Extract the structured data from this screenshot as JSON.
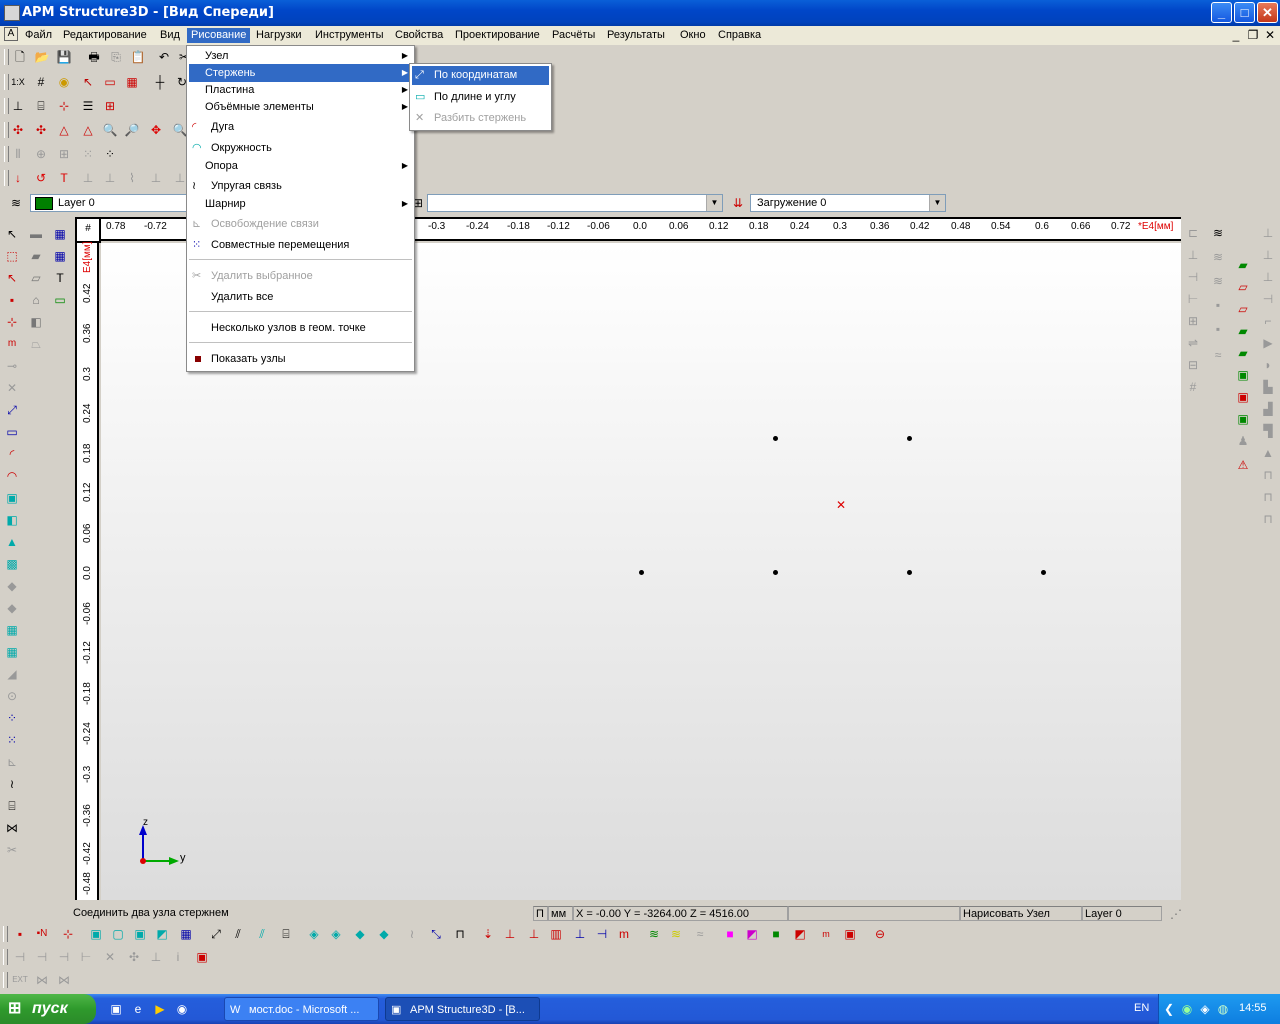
{
  "window": {
    "title": "APM Structure3D - [Вид Спереди]"
  },
  "menubar": [
    "Файл",
    "Редактирование",
    "Вид",
    "Рисование",
    "Нагрузки",
    "Инструменты",
    "Свойства",
    "Проектирование",
    "Расчёты",
    "Результаты",
    "Окно",
    "Справка"
  ],
  "draw_menu": {
    "items": [
      {
        "label": "Узел",
        "submenu": true
      },
      {
        "label": "Стержень",
        "submenu": true,
        "highlighted": true
      },
      {
        "label": "Пластина",
        "submenu": true
      },
      {
        "label": "Объёмные элементы",
        "submenu": true
      },
      {
        "label": "Дуга",
        "icon": "arc-icon"
      },
      {
        "label": "Окружность",
        "icon": "circle-icon"
      },
      {
        "label": "Опора",
        "submenu": true
      },
      {
        "label": "Упругая связь",
        "icon": "spring-icon"
      },
      {
        "label": "Шарнир",
        "submenu": true
      },
      {
        "label": "Освобождение связи",
        "disabled": true,
        "icon": "release-icon"
      },
      {
        "label": "Совместные перемещения",
        "icon": "joint-move-icon"
      },
      {
        "label": "Удалить выбранное",
        "disabled": true,
        "icon": "delete-icon"
      },
      {
        "label": "Удалить все"
      },
      {
        "label": "Несколько узлов в геом. точке"
      },
      {
        "label": "Показать узлы",
        "checked": true
      }
    ]
  },
  "rod_submenu": {
    "items": [
      {
        "label": "По координатам",
        "highlighted": true
      },
      {
        "label": "По длине и углу"
      },
      {
        "label": "Разбить стержень",
        "disabled": true
      }
    ]
  },
  "layer_combo": {
    "value": "Layer 0",
    "color": "#008000"
  },
  "load_combo": {
    "value": "Загружение 0"
  },
  "ruler_h": {
    "labels": [
      "0.78",
      "-0.72",
      "-0.3",
      "-0.24",
      "-0.18",
      "-0.12",
      "-0.06",
      "0.0",
      "0.06",
      "0.12",
      "0.18",
      "0.24",
      "0.3",
      "0.36",
      "0.42",
      "0.48",
      "0.54",
      "0.6",
      "0.66",
      "0.72"
    ],
    "unit": "*E4[мм]"
  },
  "ruler_v": {
    "labels": [
      "0.42",
      "0.36",
      "0.3",
      "0.24",
      "0.18",
      "0.12",
      "0.06",
      "0.0",
      "-0.06",
      "-0.12",
      "-0.18",
      "-0.24",
      "-0.3",
      "-0.36",
      "-0.42",
      "-0.48"
    ],
    "unit": "E4[мм]"
  },
  "axes": {
    "z": "z",
    "y": "y"
  },
  "status": {
    "hint": "Соединить два узла стержнем",
    "mode": "П",
    "units": "мм",
    "coords": "X = -0.00 Y = -3264.00 Z = 4516.00",
    "action": "Нарисовать Узел",
    "layer": "Layer 0"
  },
  "taskbar": {
    "start": "пуск",
    "tasks": [
      "мост.doc - Microsoft ...",
      "APM Structure3D - [В..."
    ],
    "lang": "EN",
    "time": "14:55"
  }
}
